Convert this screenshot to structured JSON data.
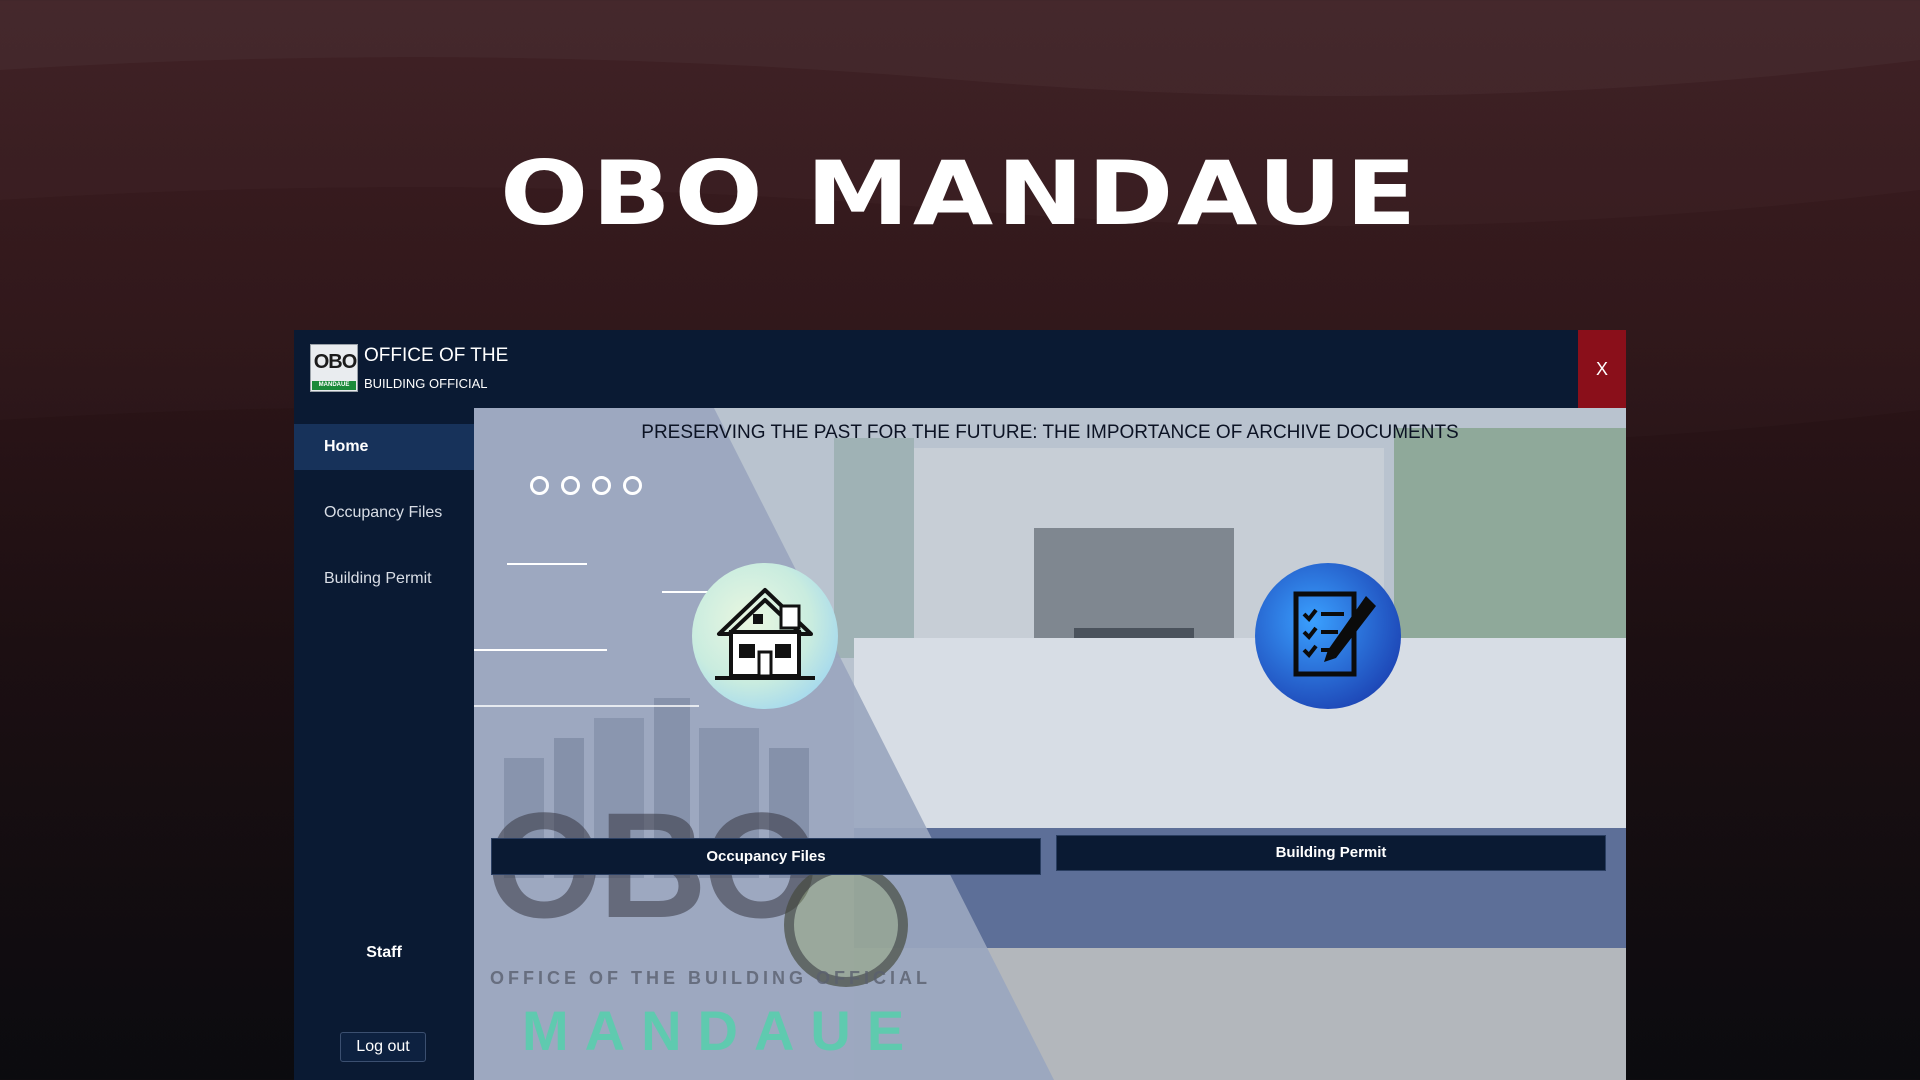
{
  "page": {
    "hero_title": "OBO MANDAUE"
  },
  "window": {
    "logo": {
      "text": "OBO",
      "subtext": "MANDAUE"
    },
    "header_line1": "OFFICE OF THE",
    "header_line2": "BUILDING OFFICIAL",
    "close_label": "X"
  },
  "sidebar": {
    "items": [
      {
        "label": "Home",
        "active": true
      },
      {
        "label": "Occupancy Files",
        "active": false
      },
      {
        "label": "Building Permit",
        "active": false
      }
    ],
    "staff_label": "Staff",
    "logout_label": "Log out"
  },
  "main": {
    "banner_title": "PRESERVING THE PAST FOR THE FUTURE: THE IMPORTANCE OF ARCHIVE DOCUMENTS",
    "slider_dots_count": 4,
    "cards": [
      {
        "icon": "house-icon",
        "label": "Occupancy Files"
      },
      {
        "icon": "document-pen-icon",
        "label": "Building Permit"
      }
    ],
    "watermark": {
      "big_text": "OBO",
      "office_text": "OFFICE OF THE BUILDING OFFICIAL",
      "city_text": "MANDAUE"
    }
  },
  "colors": {
    "header_bg": "#0a1a33",
    "close_bg": "#8a0f1a",
    "active_nav_bg": "#17325a",
    "page_bg_top": "#3a1a1e"
  }
}
